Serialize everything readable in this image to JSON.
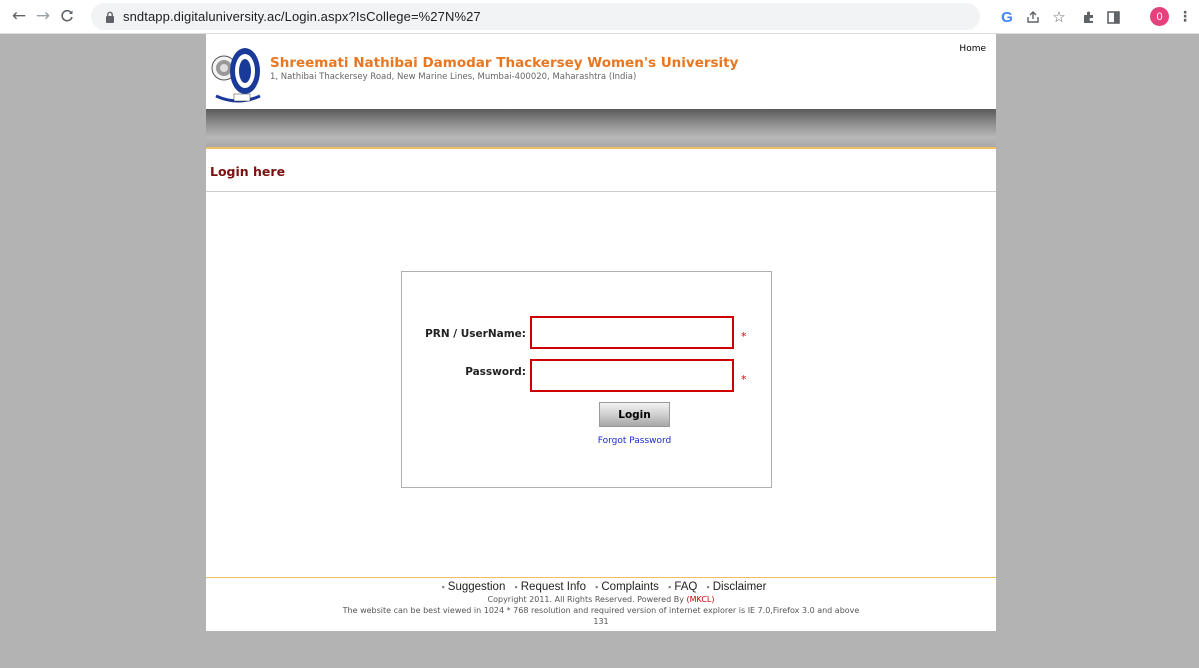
{
  "browser": {
    "url": "sndtapp.digitaluniversity.ac/Login.aspx?IsCollege=%27N%27",
    "profile_initial": "0",
    "icons": [
      "back-icon",
      "forward-icon",
      "reload-icon",
      "lock-icon",
      "google-icon",
      "share-icon",
      "bookmark-star-icon",
      "extensions-icon",
      "side-panel-icon",
      "menu-icon"
    ],
    "google_glyph": "G"
  },
  "header": {
    "university_name": "Shreemati Nathibai Damodar Thackersey Women's University",
    "address": "1, Nathibai Thackersey Road, New Marine Lines, Mumbai-400020, Maharashtra (India)",
    "home_link": "Home"
  },
  "login": {
    "title": "Login here",
    "username_label": "PRN / UserName:",
    "password_label": "Password:",
    "username_value": "",
    "password_value": "",
    "required_mark": "*",
    "button_label": "Login",
    "forgot_link": "Forgot Password"
  },
  "footer": {
    "links": [
      "Suggestion",
      "Request Info",
      "Complaints",
      "FAQ",
      "Disclaimer"
    ],
    "copyright_prefix": "Copyright 2011. All Rights Reserved. Powered By",
    "powered_by": "(MKCL)",
    "browser_note": "The website can be best viewed in 1024 * 768 resolution and required version of internet explorer is IE 7.0,Firefox 3.0 and above",
    "counter": "131"
  },
  "colors": {
    "university_name": "#e87722",
    "login_title": "#7a1010",
    "input_border": "#cc0000",
    "link": "#1a2ad0",
    "page_background": "#b3b3b3"
  }
}
